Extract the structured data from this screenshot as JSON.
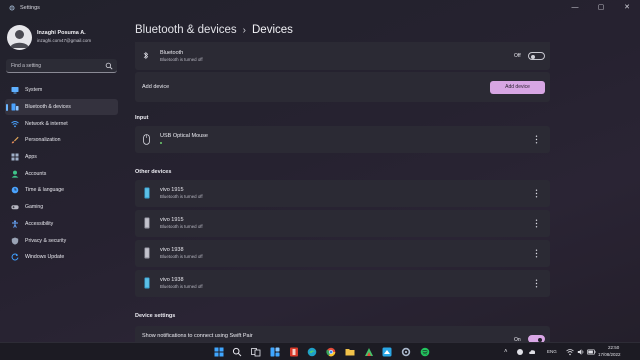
{
  "window": {
    "app_title": "Settings",
    "minimize": "—",
    "maximize": "▢",
    "close": "✕"
  },
  "profile": {
    "name": "Inzaghi Posuma A.",
    "email": "inzaghi.com47@gmail.com"
  },
  "search": {
    "placeholder": "Find a setting"
  },
  "nav": {
    "items": [
      {
        "label": "System",
        "icon": "monitor-icon",
        "color": "#5fb0ff"
      },
      {
        "label": "Bluetooth & devices",
        "icon": "bluetooth-devices-icon",
        "color": "#4aa3ff",
        "selected": true
      },
      {
        "label": "Network & internet",
        "icon": "wifi-icon",
        "color": "#4aa3ff"
      },
      {
        "label": "Personalization",
        "icon": "brush-icon",
        "color": "#e4a95a"
      },
      {
        "label": "Apps",
        "icon": "apps-icon",
        "color": "#9fb0c8"
      },
      {
        "label": "Accounts",
        "icon": "person-icon",
        "color": "#3ec48a"
      },
      {
        "label": "Time & language",
        "icon": "globe-clock-icon",
        "color": "#4aa3ff"
      },
      {
        "label": "Gaming",
        "icon": "gamepad-icon",
        "color": "#b7b7c2"
      },
      {
        "label": "Accessibility",
        "icon": "accessibility-icon",
        "color": "#6aa9ff"
      },
      {
        "label": "Privacy & security",
        "icon": "shield-icon",
        "color": "#9aa3b5"
      },
      {
        "label": "Windows Update",
        "icon": "update-icon",
        "color": "#3f9fff"
      }
    ]
  },
  "header": {
    "parent": "Bluetooth & devices",
    "separator": "›",
    "current": "Devices"
  },
  "bluetooth": {
    "title": "Bluetooth",
    "status": "Bluetooth is turned off",
    "toggle_label": "Off",
    "toggle_on": false
  },
  "add_device": {
    "label": "Add device",
    "button": "Add device"
  },
  "input_section": {
    "heading": "Input",
    "devices": [
      {
        "name": "USB Optical Mouse",
        "status": ""
      }
    ]
  },
  "other_devices": {
    "heading": "Other devices",
    "devices": [
      {
        "name": "vivo 1915",
        "status": "Bluetooth is turned off",
        "icon": "phone-icon",
        "accent": "#3aa6d6"
      },
      {
        "name": "vivo 1915",
        "status": "Bluetooth is turned off",
        "icon": "phone-icon",
        "accent": "#9a9aa6"
      },
      {
        "name": "vivo 1938",
        "status": "Bluetooth is turned off",
        "icon": "phone-icon",
        "accent": "#9a9aa6"
      },
      {
        "name": "vivo 1938",
        "status": "Bluetooth is turned off",
        "icon": "phone-icon",
        "accent": "#3aa6d6"
      }
    ]
  },
  "device_settings": {
    "heading": "Device settings",
    "swift_pair_label": "Show notifications to connect using Swift Pair",
    "swift_pair_toggle_label": "On",
    "swift_pair_on": true
  },
  "taskbar": {
    "language": "ENG",
    "time": "22:50",
    "date": "17/08/2022"
  },
  "colors": {
    "accent": "#d7a6e3",
    "selection_bar": "#6bb6ff"
  }
}
